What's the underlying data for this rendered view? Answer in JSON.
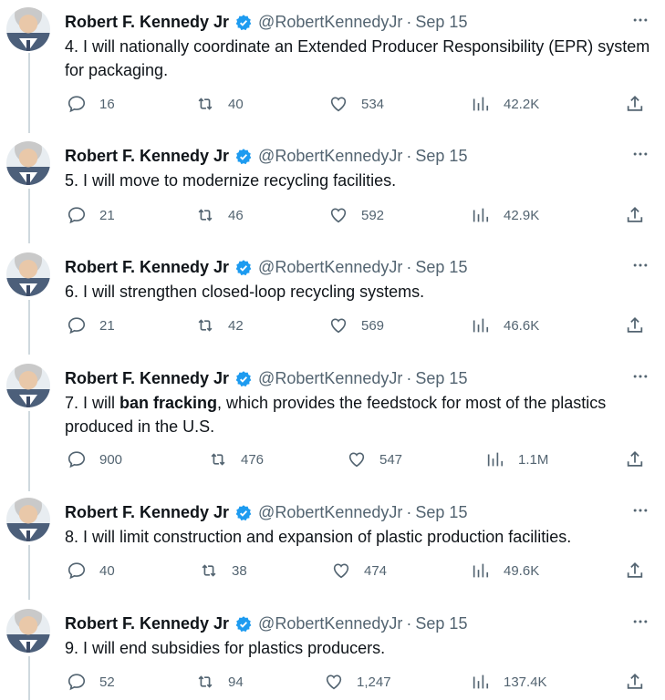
{
  "author": {
    "name": "Robert F. Kennedy Jr",
    "handle": "@RobertKennedyJr",
    "separator": "·",
    "verified_color": "#1d9bf0"
  },
  "tweets": [
    {
      "date": "Sep 15",
      "text_plain_before": "4. I will nationally coordinate an Extended Producer Responsibility (EPR) system for packaging.",
      "replies": "16",
      "retweets": "40",
      "likes": "534",
      "views": "42.2K"
    },
    {
      "date": "Sep 15",
      "text_plain_before": "5. I will move to modernize recycling facilities.",
      "replies": "21",
      "retweets": "46",
      "likes": "592",
      "views": "42.9K"
    },
    {
      "date": "Sep 15",
      "text_plain_before": "6. I will strengthen closed-loop recycling systems.",
      "replies": "21",
      "retweets": "42",
      "likes": "569",
      "views": "46.6K"
    },
    {
      "date": "Sep 15",
      "text_plain_before": "7. I will ",
      "text_bold": "ban fracking",
      "text_plain_after": ", which provides the feedstock for most of the plastics produced in the U.S.",
      "replies": "900",
      "retweets": "476",
      "likes": "547",
      "views": "1.1M"
    },
    {
      "date": "Sep 15",
      "text_plain_before": "8. I will limit construction and expansion of plastic production facilities.",
      "replies": "40",
      "retweets": "38",
      "likes": "474",
      "views": "49.6K"
    },
    {
      "date": "Sep 15",
      "text_plain_before": "9. I will end subsidies for plastics producers.",
      "replies": "52",
      "retweets": "94",
      "likes": "1,247",
      "views": "137.4K"
    }
  ],
  "icons": {
    "reply": "reply-icon",
    "retweet": "retweet-icon",
    "like": "like-icon",
    "views": "views-icon",
    "share": "share-icon",
    "more": "more-icon",
    "verified": "verified-badge-icon"
  }
}
